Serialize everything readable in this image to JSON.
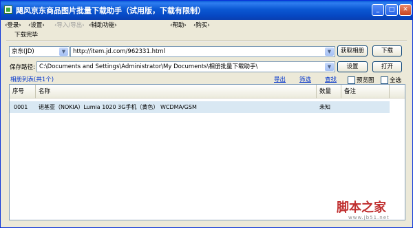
{
  "window": {
    "title": "飓风京东商品图片批量下载助手（试用版，下载有限制）",
    "min": "_",
    "max": "□",
    "close": "✕"
  },
  "menu": {
    "login": "登录",
    "settings": "设置",
    "import_export": "导入/导出",
    "assist": "辅助功能",
    "help": "帮助",
    "buy": "购买"
  },
  "status": "下载完毕",
  "toolbar": {
    "site_select": "京东(JD)",
    "url_value": "http://item.jd.com/962331.html",
    "get_album_button": "获取相册",
    "download_button": "下载"
  },
  "savepath": {
    "label": "保存路径:",
    "value": "C:\\Documents and Settings\\Administrator\\My Documents\\相册批量下载助手\\",
    "settings_button": "设置",
    "open_button": "打开"
  },
  "list": {
    "title": "相册列表(共1个)",
    "export_link": "导出",
    "filter_link": "筛选",
    "find_link": "查找",
    "preview_label": "预览图",
    "select_all_label": "全选",
    "columns": [
      "序号",
      "名称",
      "数量",
      "备注"
    ],
    "rows": [
      {
        "index": "0001",
        "name": "诺基亚（NOKIA）Lumia 1020 3G手机（黄色） WCDMA/GSM",
        "count": "未知",
        "note": ""
      }
    ]
  },
  "watermark": {
    "text": "脚本之家",
    "url": "www.jb51.net"
  }
}
